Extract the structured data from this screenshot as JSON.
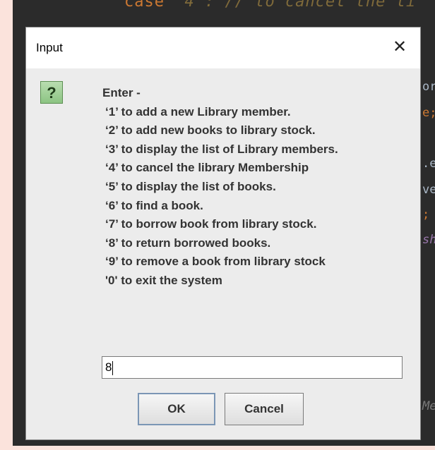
{
  "editor": {
    "top_code_keyword": "case",
    "top_code_rest": "'4': // to cancel the li",
    "side_fragments": [
      {
        "text": "or",
        "color": "#a9b7c6"
      },
      {
        "text": "e;",
        "color": "#cc7832"
      },
      {
        "text": ":",
        "color": "#a9b7c6"
      },
      {
        "text": ".e",
        "color": "#a9b7c6"
      },
      {
        "text": "ve",
        "color": "#a9b7c6"
      },
      {
        "text": ";",
        "color": "#cc7832"
      },
      {
        "text": "sh",
        "color": "#9876aa"
      },
      {
        "text": "Me",
        "color": "#7a7a7a"
      }
    ]
  },
  "dialog": {
    "title": "Input",
    "close_glyph": "✕",
    "icon_glyph": "?",
    "message_lines": [
      "Enter -",
      "‘1’ to add a new Library member.",
      "‘2’ to add new books to library stock.",
      "‘3’ to display the list of Library members.",
      "‘4’ to cancel the library Membership",
      "‘5’ to display the list of books.",
      "‘6’ to find a book.",
      "‘7’ to borrow book from library stock.",
      "‘8’ to return borrowed books.",
      "‘9’ to remove a book from library stock",
      "'0' to exit the system"
    ],
    "input_value": "8",
    "ok_label": "OK",
    "cancel_label": "Cancel"
  },
  "colors": {
    "page_background": "#fbe3dc",
    "editor_background": "#2b2b2b",
    "dialog_background": "#ececec",
    "icon_green": "#8cc483"
  }
}
